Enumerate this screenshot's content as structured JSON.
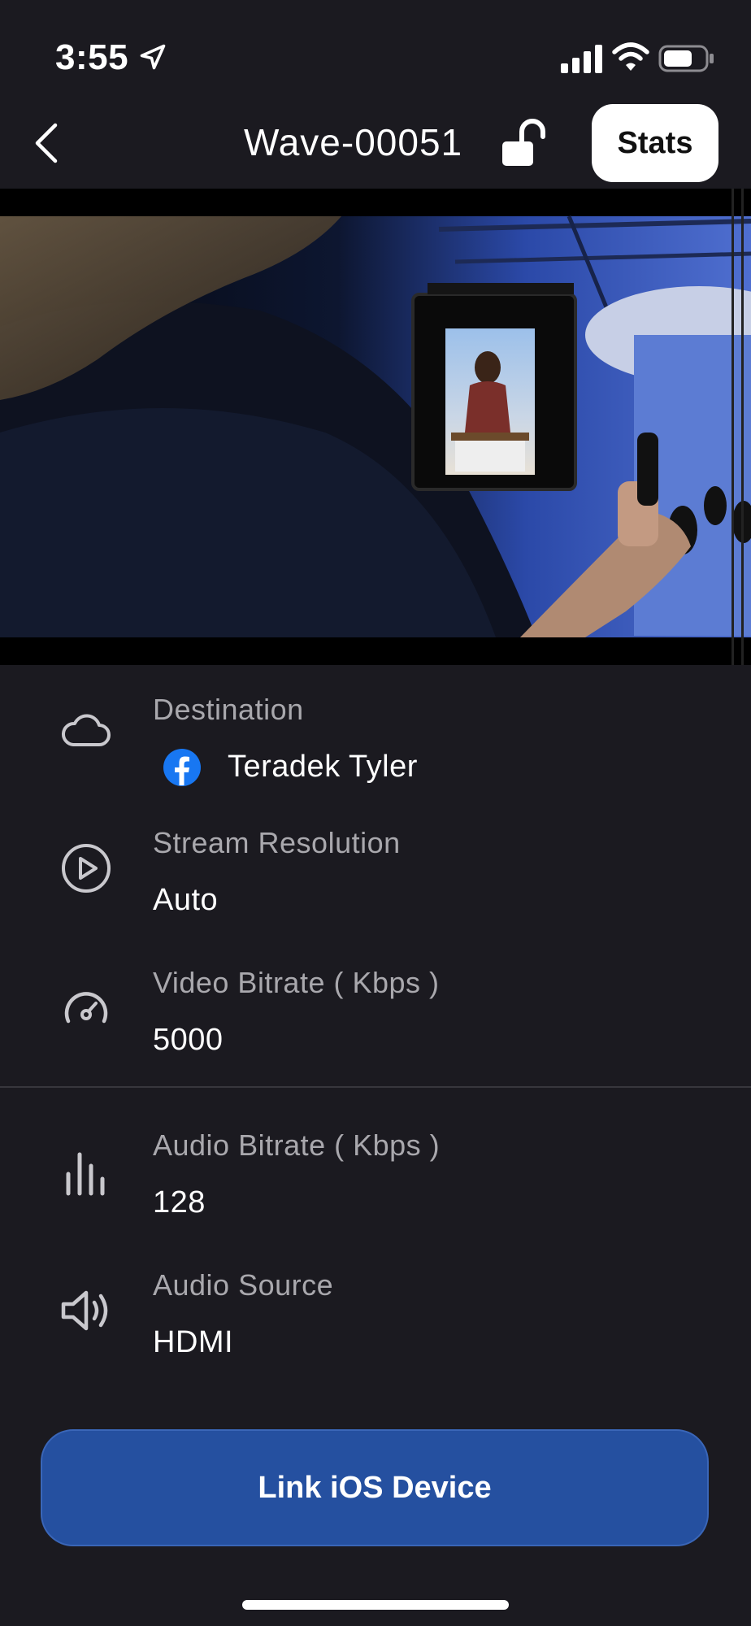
{
  "status_bar": {
    "time": "3:55",
    "icons": [
      "location-arrow-icon",
      "cellular-signal-icon",
      "wifi-icon",
      "battery-icon"
    ]
  },
  "nav": {
    "title": "Wave-00051",
    "stats_label": "Stats",
    "icons": [
      "chevron-left-icon",
      "unlock-icon"
    ]
  },
  "settings": {
    "destination": {
      "label": "Destination",
      "value": "Teradek Tyler",
      "icon": "cloud-icon",
      "value_icon": "facebook-icon"
    },
    "stream_resolution": {
      "label": "Stream Resolution",
      "value": "Auto",
      "icon": "play-circle-icon"
    },
    "video_bitrate": {
      "label": "Video Bitrate ( Kbps )",
      "value": "5000",
      "icon": "speedometer-icon"
    },
    "audio_bitrate": {
      "label": "Audio Bitrate ( Kbps )",
      "value": "128",
      "icon": "audio-bars-icon"
    },
    "audio_source": {
      "label": "Audio Source",
      "value": "HDMI",
      "icon": "speaker-icon"
    }
  },
  "actions": {
    "link_button_label": "Link iOS Device"
  },
  "colors": {
    "background": "#1b1a20",
    "accent_button": "#2550a0",
    "label_gray": "#a9a8ad",
    "facebook_blue": "#1877f2"
  }
}
